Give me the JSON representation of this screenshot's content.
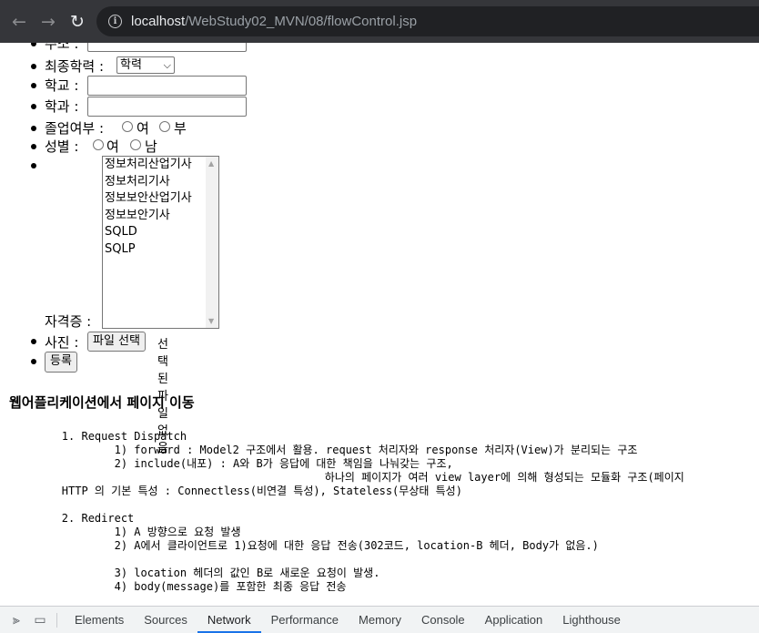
{
  "browser": {
    "url_host": "localhost",
    "url_path": "/WebStudy02_MVN/08/flowControl.jsp"
  },
  "form": {
    "address_label": "주소 :",
    "education_label": "최종학력 :",
    "education_selected": "학력",
    "school_label": "학교 :",
    "major_label": "학과 :",
    "graduated_label": "졸업여부 :",
    "graduated_options": [
      "여",
      "부"
    ],
    "gender_label": "성별 :",
    "gender_options": [
      "여",
      "남"
    ],
    "license_label": "자격증 :",
    "license_options": [
      "정보처리산업기사",
      "정보처리기사",
      "정보보안산업기사",
      "정보보안기사",
      "SQLD",
      "SQLP"
    ],
    "photo_label": "사진 :",
    "file_button": "파일 선택",
    "file_status": "선택된 파일 없음",
    "submit_button": "등록"
  },
  "section": {
    "heading": "웹어플리케이션에서 페이지 이동",
    "notes": "\t1. Request Dispatch\n\t\t1) forward : Model2 구조에서 활용. request 처리자와 response 처리자(View)가 분리되는 구조\n\t\t2) include(내포) : A와 B가 응답에 대한 책임을 나눠갖는 구조,\n\t\t\t\t\t\t하나의 페이지가 여러 view layer에 의해 형성되는 모듈화 구조(페이지\n\tHTTP 의 기본 특성 : Connectless(비연결 특성), Stateless(무상태 특성)\n\n\t2. Redirect\n\t\t1) A 방향으로 요청 발생\n\t\t2) A에서 클라이언트로 1)요청에 대한 응답 전송(302코드, location-B 헤더, Body가 없음.)\n\n\t\t3) location 헤더의 값인 B로 새로운 요청이 발생.\n\t\t4) body(message)를 포함한 최종 응답 전송"
  },
  "devtools": {
    "tabs": [
      "Elements",
      "Sources",
      "Network",
      "Performance",
      "Memory",
      "Console",
      "Application",
      "Lighthouse"
    ],
    "active_tab": "Network"
  }
}
